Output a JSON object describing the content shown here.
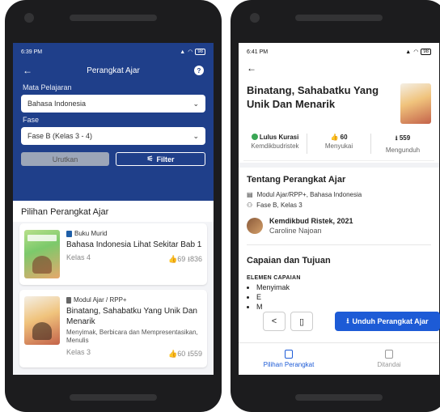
{
  "left": {
    "status": {
      "time": "6:39 PM",
      "battery": "98"
    },
    "appbar": {
      "title": "Perangkat Ajar"
    },
    "filters": {
      "subject_label": "Mata Pelajaran",
      "subject_value": "Bahasa Indonesia",
      "phase_label": "Fase",
      "phase_value": "Fase B (Kelas 3 - 4)"
    },
    "buttons": {
      "sort": "Urutkan",
      "filter": "Filter"
    },
    "section_title": "Pilihan Perangkat Ajar",
    "cards": [
      {
        "type": "Buku Murid",
        "title": "Bahasa Indonesia Lihat Sekitar Bab 1",
        "description": "",
        "grade": "Kelas 4",
        "likes": "69",
        "downloads": "836"
      },
      {
        "type": "Modul Ajar / RPP+",
        "title": "Binatang, Sahabatku Yang Unik Dan Menarik",
        "description": "Menyimak, Berbicara dan Mempresentasikan, Menulis",
        "grade": "Kelas 3",
        "likes": "60",
        "downloads": "559"
      }
    ]
  },
  "right": {
    "status": {
      "time": "6:41 PM",
      "battery": "98"
    },
    "title": "Binatang, Sahabatku Yang Unik Dan Menarik",
    "stats": [
      {
        "value": "Lulus Kurasi",
        "label": "Kemdikbudristek"
      },
      {
        "value": "60",
        "label": "Menyukai"
      },
      {
        "value": "559",
        "label": "Mengunduh"
      }
    ],
    "about_title": "Tentang Perangkat Ajar",
    "info": {
      "type": "Modul Ajar/RPP+, Bahasa Indonesia",
      "phase": "Fase B, Kelas 3"
    },
    "author": {
      "org": "Kemdikbud Ristek, 2021",
      "name": "Caroline Najoan"
    },
    "goals_title": "Capaian dan Tujuan",
    "element_label": "ELEMEN CAPAIAN",
    "bullets": [
      "Menyimak",
      "E",
      "M"
    ],
    "download_label": "Unduh Perangkat Ajar",
    "nav": [
      {
        "label": "Pilihan Perangkat",
        "active": true
      },
      {
        "label": "Ditandai",
        "active": false
      }
    ]
  }
}
